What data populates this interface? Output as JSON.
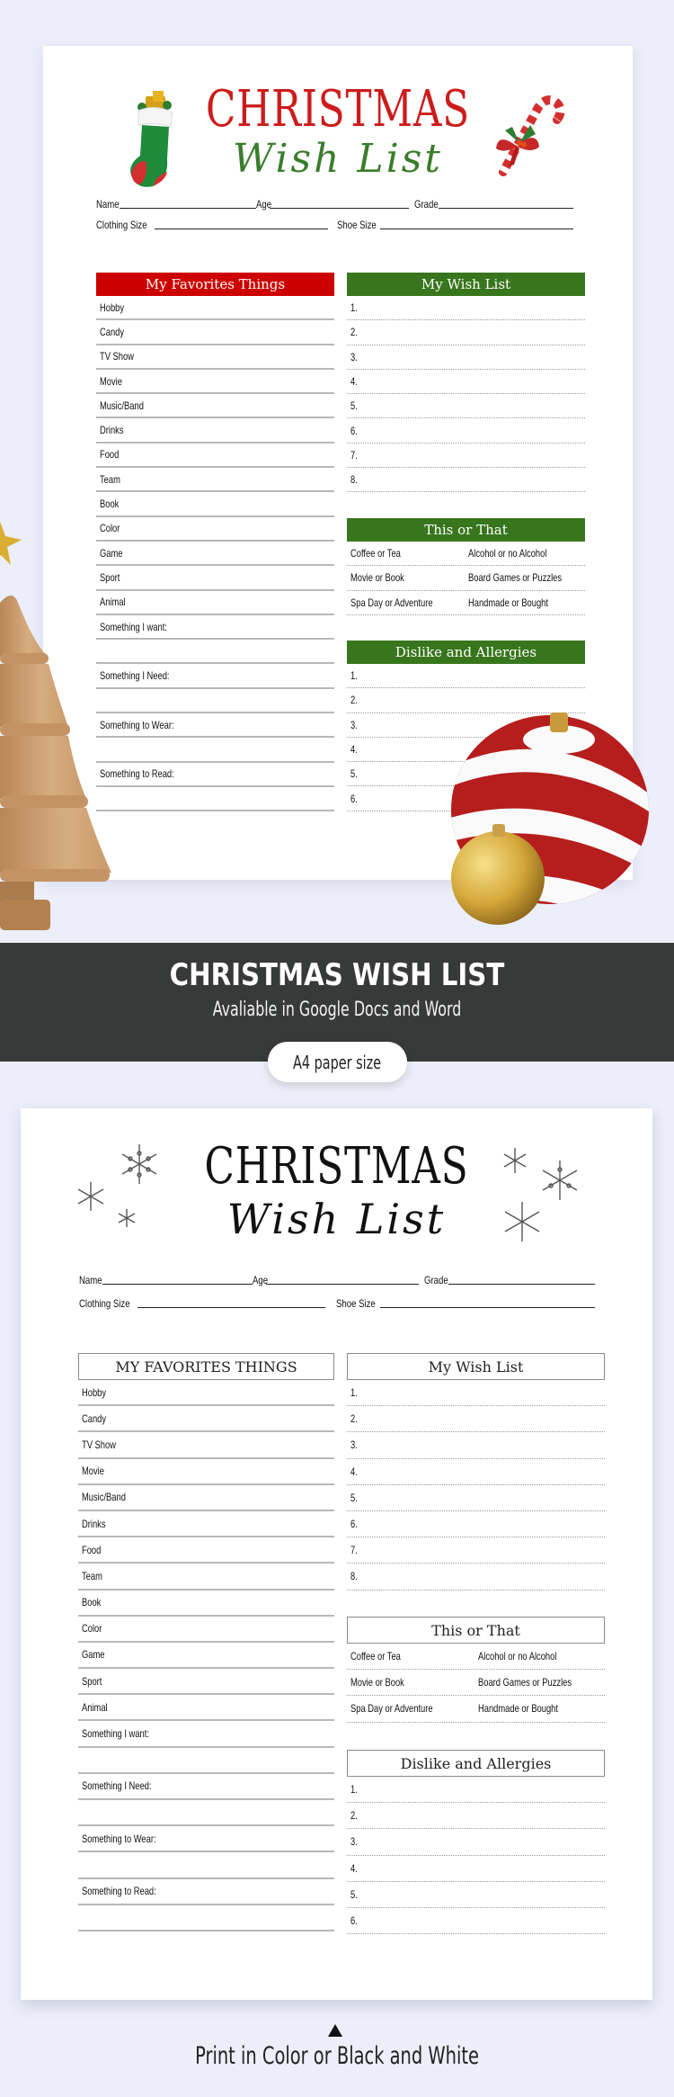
{
  "colors": {
    "background": "#ECEEF9",
    "red": "#CC0000",
    "green": "#38761D",
    "band": "#383A39"
  },
  "color_sheet": {
    "title_line1": "CHRISTMAS",
    "title_line2": "Wish List",
    "decorations": [
      "stocking-icon",
      "candy-cane-icon"
    ],
    "fields_row1": [
      "Name",
      "Age",
      "Grade"
    ],
    "fields_row2": [
      "Clothing Size",
      "Shoe Size"
    ],
    "favorites": {
      "header": "My Favorites Things",
      "items": [
        "Hobby",
        "Candy",
        "TV Show",
        "Movie",
        "Music/Band",
        "Drinks",
        "Food",
        "Team",
        "Book",
        "Color",
        "Game",
        "Sport",
        "Animal",
        "Something I want:",
        "",
        "Something I Need:",
        "",
        "Something to Wear:",
        "",
        "Something to Read:",
        ""
      ]
    },
    "wishlist": {
      "header": "My Wish List",
      "items": [
        "1.",
        "2.",
        "3.",
        "4.",
        "5.",
        "6.",
        "7.",
        "8."
      ]
    },
    "this_or_that": {
      "header": "This or That",
      "rows": [
        [
          "Coffee or Tea",
          "Alcohol or no Alcohol"
        ],
        [
          "Movie or Book",
          "Board Games or Puzzles"
        ],
        [
          "Spa Day or Adventure",
          "Handmade or Bought"
        ]
      ]
    },
    "dislikes": {
      "header": "Dislike and Allergies",
      "items": [
        "1.",
        "2.",
        "3.",
        "4.",
        "5.",
        "6."
      ]
    }
  },
  "banner": {
    "title": "CHRISTMAS WISH LIST",
    "subtitle": "Avaliable in Google Docs and Word",
    "pill": "A4 paper size"
  },
  "bw_sheet": {
    "title_line1": "CHRISTMAS",
    "title_line2": "Wish List",
    "decorations": [
      "snowflake-icon"
    ],
    "fields_row1": [
      "Name",
      "Age",
      "Grade"
    ],
    "fields_row2": [
      "Clothing Size",
      "Shoe Size"
    ],
    "favorites": {
      "header": "MY FAVORITES THINGS",
      "items": [
        "Hobby",
        "Candy",
        "TV Show",
        "Movie",
        "Music/Band",
        "Drinks",
        "Food",
        "Team",
        "Book",
        "Color",
        "Game",
        "Sport",
        "Animal",
        "Something I want:",
        "",
        "Something I Need:",
        "",
        "Something to Wear:",
        "",
        "Something to Read:",
        ""
      ]
    },
    "wishlist": {
      "header": "My Wish List",
      "items": [
        "1.",
        "2.",
        "3.",
        "4.",
        "5.",
        "6.",
        "7.",
        "8."
      ]
    },
    "this_or_that": {
      "header": "This or That",
      "rows": [
        [
          "Coffee or Tea",
          "Alcohol or no Alcohol"
        ],
        [
          "Movie or Book",
          "Board Games or Puzzles"
        ],
        [
          "Spa Day or Adventure",
          "Handmade or Bought"
        ]
      ]
    },
    "dislikes": {
      "header": "Dislike and Allergies",
      "items": [
        "1.",
        "2.",
        "3.",
        "4.",
        "5.",
        "6."
      ]
    }
  },
  "footer": {
    "arrow": "triangle-up-icon",
    "text": "Print in Color or Black and White"
  }
}
